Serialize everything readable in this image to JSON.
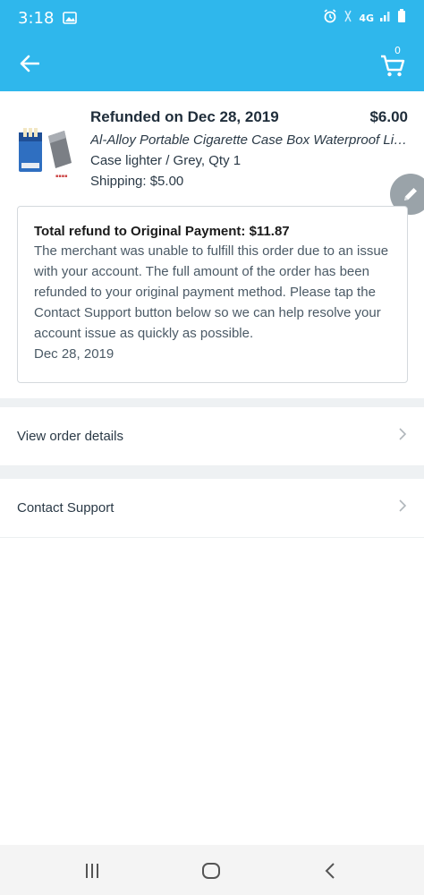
{
  "status_bar": {
    "time": "3:18",
    "network_label": "4G"
  },
  "app_bar": {
    "cart_count": "0",
    "accent_color": "#2fb7ec"
  },
  "product": {
    "refund_title": "Refunded on Dec 28, 2019",
    "price": "$6.00",
    "name": "Al-Alloy Portable Cigarette Case Box Waterproof Lighter",
    "variant": "Case lighter / Grey, Qty 1",
    "shipping": "Shipping: $5.00"
  },
  "refund_card": {
    "total": "Total refund to Original Payment: $11.87",
    "message": "The merchant was unable to fulfill this order due to an issue with your account. The full amount of the order has been refunded to your original payment method. Please tap the Contact Support button below so we can help resolve your account issue as quickly as possible.",
    "date": "Dec 28, 2019"
  },
  "menu": {
    "view_order_details": "View order details",
    "contact_support": "Contact Support"
  },
  "icons": {
    "back": "arrow-left",
    "cart": "cart",
    "edit": "pencil",
    "chevron": "chevron-right",
    "nav_recents": "recents",
    "nav_home": "home",
    "nav_back": "chevron-left"
  }
}
